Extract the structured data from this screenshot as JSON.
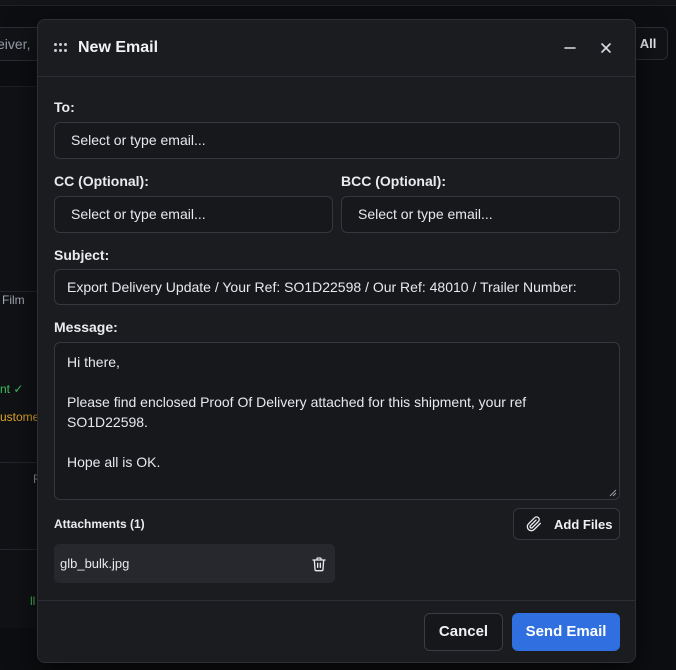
{
  "background": {
    "search_fragment": "eiver,",
    "all_button": "All",
    "film_fragment": "Film",
    "sent_fragment": "nt ✓",
    "customer_fragment": "ustome",
    "letter_f": "F",
    "letter_ll": "ll"
  },
  "modal": {
    "title": "New Email",
    "to": {
      "label": "To:",
      "placeholder": "Select or type email..."
    },
    "cc": {
      "label": "CC (Optional):",
      "placeholder": "Select or type email..."
    },
    "bcc": {
      "label": "BCC (Optional):",
      "placeholder": "Select or type email..."
    },
    "subject": {
      "label": "Subject:",
      "value": "Export Delivery Update / Your Ref: SO1D22598 / Our Ref: 48010 / Trailer Number:"
    },
    "message": {
      "label": "Message:",
      "lines": [
        "Hi there,",
        "",
        "Please find enclosed Proof Of Delivery attached for this shipment, your ref",
        "SO1D22598.",
        "",
        "Hope all is OK."
      ]
    },
    "attachments": {
      "label": "Attachments (1)",
      "add_files_label": "Add Files",
      "files": [
        {
          "name": "glb_bulk.jpg"
        }
      ]
    },
    "footer": {
      "cancel_label": "Cancel",
      "send_label": "Send Email"
    }
  },
  "colors": {
    "accent": "#2f6fe0",
    "success": "#3fbf5a",
    "warning": "#e0a526",
    "modal_bg": "#1b1c20",
    "page_bg": "#0d0e11"
  },
  "icons": {
    "drag": "drag-handle-icon",
    "minimize": "minimize-icon",
    "close": "close-icon",
    "attach": "paperclip-icon",
    "delete": "trash-icon"
  }
}
